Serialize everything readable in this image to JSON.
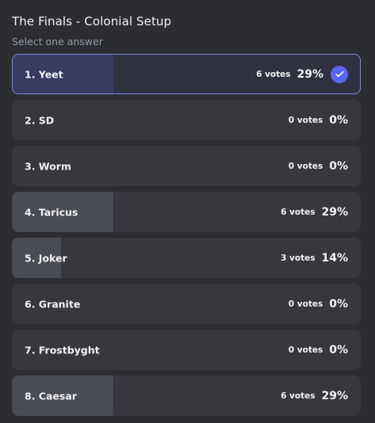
{
  "poll": {
    "title": "The Finals - Colonial Setup",
    "subtitle": "Select one answer",
    "accent_color": "#5865f2",
    "answers": [
      {
        "label": "1. Yeet",
        "votes": "6 votes",
        "percent": "29%",
        "fraction": 0.29,
        "selected": true
      },
      {
        "label": "2. SD",
        "votes": "0 votes",
        "percent": "0%",
        "fraction": 0.0,
        "selected": false
      },
      {
        "label": "3. Worm",
        "votes": "0 votes",
        "percent": "0%",
        "fraction": 0.0,
        "selected": false
      },
      {
        "label": "4. Taricus",
        "votes": "6 votes",
        "percent": "29%",
        "fraction": 0.29,
        "selected": false
      },
      {
        "label": "5. Joker",
        "votes": "3 votes",
        "percent": "14%",
        "fraction": 0.14,
        "selected": false
      },
      {
        "label": "6. Granite",
        "votes": "0 votes",
        "percent": "0%",
        "fraction": 0.0,
        "selected": false
      },
      {
        "label": "7. Frostbyght",
        "votes": "0 votes",
        "percent": "0%",
        "fraction": 0.0,
        "selected": false
      },
      {
        "label": "8. Caesar",
        "votes": "6 votes",
        "percent": "29%",
        "fraction": 0.29,
        "selected": false
      }
    ],
    "selected_icon": "checkmark-icon"
  }
}
